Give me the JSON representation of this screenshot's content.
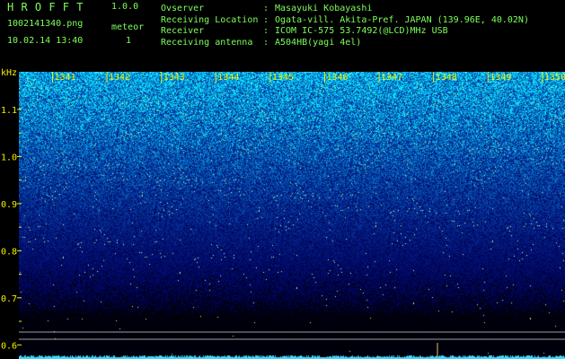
{
  "header": {
    "app_name": "H R O F F T",
    "version": "1.0.0",
    "filename": "1002141340.png",
    "datetime": "10.02.14 13:40",
    "meteor_label": "meteor",
    "meteor_count": "1"
  },
  "info": {
    "rows": [
      {
        "label": "Ovserver",
        "sep": ":",
        "value": "Masayuki Kobayashi"
      },
      {
        "label": "Receiving Location",
        "sep": ":",
        "value": "Ogata-vill. Akita-Pref. JAPAN (139.96E, 40.02N)"
      },
      {
        "label": "Receiver",
        "sep": ":",
        "value": "ICOM IC-575 53.7492(@LCD)MHz USB"
      },
      {
        "label": "Receiving antenna",
        "sep": ":",
        "value": "A504HB(yagi 4el)"
      }
    ]
  },
  "chart_data": {
    "type": "heatmap",
    "y_unit": "kHz",
    "y_ticks": [
      "1.1",
      "1.0",
      "0.9",
      "0.8",
      "0.7",
      "0.6"
    ],
    "x_ticks": [
      "1341",
      "1342",
      "1343",
      "1344",
      "1345",
      "1346",
      "1347",
      "1348",
      "1349",
      "1350"
    ],
    "ylim": [
      0.57,
      1.18
    ],
    "colors": {
      "label": "#f2f200",
      "text": "#7cff5a",
      "noise_high": "#4fb8ff",
      "noise_low": "#0a0a3a"
    }
  }
}
